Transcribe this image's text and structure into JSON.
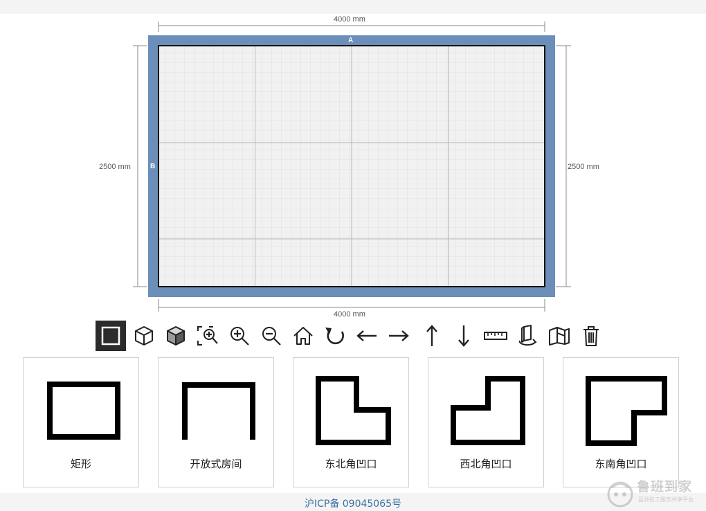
{
  "plan": {
    "top_dimension": "4000 mm",
    "bottom_dimension": "4000 mm",
    "left_dimension": "2500 mm",
    "right_dimension": "2500 mm",
    "wall_a_label": "A",
    "wall_b_label": "B",
    "wall_color": "#6b8fb8",
    "floor_color": "#f1f1f1"
  },
  "toolbar": {
    "tools": [
      {
        "name": "draw-2d",
        "active": true
      },
      {
        "name": "view-3d-outline"
      },
      {
        "name": "view-3d-solid"
      },
      {
        "name": "zoom-fit"
      },
      {
        "name": "zoom-in"
      },
      {
        "name": "zoom-out"
      },
      {
        "name": "home"
      },
      {
        "name": "rotate"
      },
      {
        "name": "move-left"
      },
      {
        "name": "move-right"
      },
      {
        "name": "move-up"
      },
      {
        "name": "move-down"
      },
      {
        "name": "ruler"
      },
      {
        "name": "rotate-3d"
      },
      {
        "name": "open-room"
      },
      {
        "name": "delete"
      }
    ]
  },
  "room_templates": [
    {
      "label": "矩形"
    },
    {
      "label": "开放式房间"
    },
    {
      "label": "东北角凹口"
    },
    {
      "label": "西北角凹口"
    },
    {
      "label": "东南角凹口"
    }
  ],
  "footer": {
    "icp": "沪ICP备 09045065号"
  },
  "logo": {
    "name": "鲁班到家",
    "tagline": "蓝领技工服务共享平台"
  }
}
